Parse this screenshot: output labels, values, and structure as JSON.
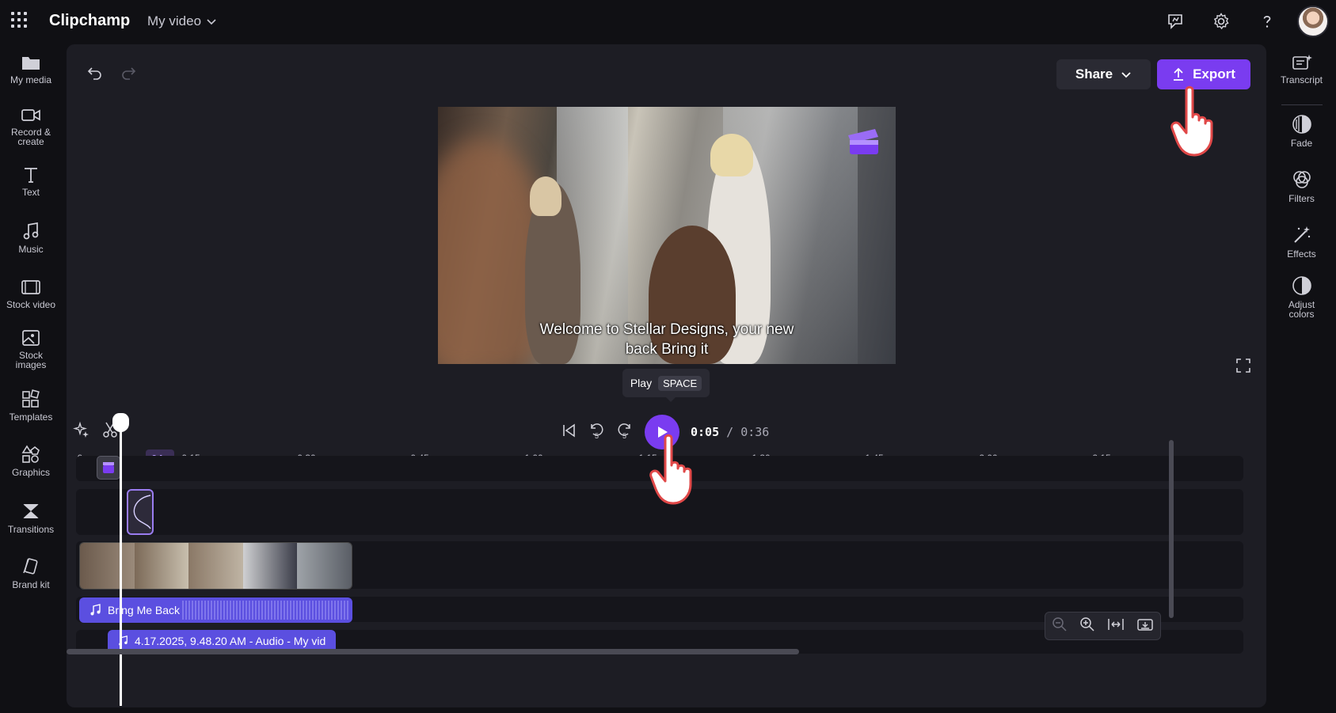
{
  "app": {
    "name": "Clipchamp",
    "project_title": "My video"
  },
  "left_rail": [
    {
      "id": "my-media",
      "label": "My media",
      "icon": "folder-icon"
    },
    {
      "id": "record",
      "label": "Record &\ncreate",
      "icon": "camera-icon"
    },
    {
      "id": "text",
      "label": "Text",
      "icon": "text-icon"
    },
    {
      "id": "music",
      "label": "Music",
      "icon": "music-icon"
    },
    {
      "id": "stock-video",
      "label": "Stock video",
      "icon": "film-icon"
    },
    {
      "id": "stock-images",
      "label": "Stock\nimages",
      "icon": "image-icon"
    },
    {
      "id": "templates",
      "label": "Templates",
      "icon": "templates-icon"
    },
    {
      "id": "graphics",
      "label": "Graphics",
      "icon": "shapes-icon"
    },
    {
      "id": "transitions",
      "label": "Transitions",
      "icon": "transitions-icon"
    },
    {
      "id": "brand-kit",
      "label": "Brand kit",
      "icon": "brand-kit-icon"
    }
  ],
  "right_rail": [
    {
      "id": "transcript",
      "label": "Transcript",
      "icon": "transcript-icon"
    },
    {
      "id": "fade",
      "label": "Fade",
      "icon": "fade-icon"
    },
    {
      "id": "filters",
      "label": "Filters",
      "icon": "filters-icon"
    },
    {
      "id": "effects",
      "label": "Effects",
      "icon": "effects-icon"
    },
    {
      "id": "adjust-colors",
      "label": "Adjust\ncolors",
      "icon": "adjust-colors-icon"
    }
  ],
  "header": {
    "share_label": "Share",
    "export_label": "Export"
  },
  "preview": {
    "subtitle": "Welcome to Stellar Designs, your new\nback Bring it"
  },
  "tooltip": {
    "label": "Play",
    "shortcut": "SPACE"
  },
  "player": {
    "current_time": "0:05",
    "total_time": "/ 0:36"
  },
  "ruler": {
    "playhead_label": "04s",
    "ticks": [
      "0",
      "0:15",
      "0:30",
      "0:45",
      "1:00",
      "1:15",
      "1:30",
      "1:45",
      "2:00",
      "2:15"
    ]
  },
  "tracks": {
    "audio_clip_1": "Bring Me Back",
    "audio_clip_2": "4.17.2025, 9.48.20 AM - Audio - My vid"
  },
  "colors": {
    "accent": "#7a3cf0",
    "audio_clip": "#5b4fe0",
    "workspace": "#1d1d24",
    "background": "#101014"
  }
}
